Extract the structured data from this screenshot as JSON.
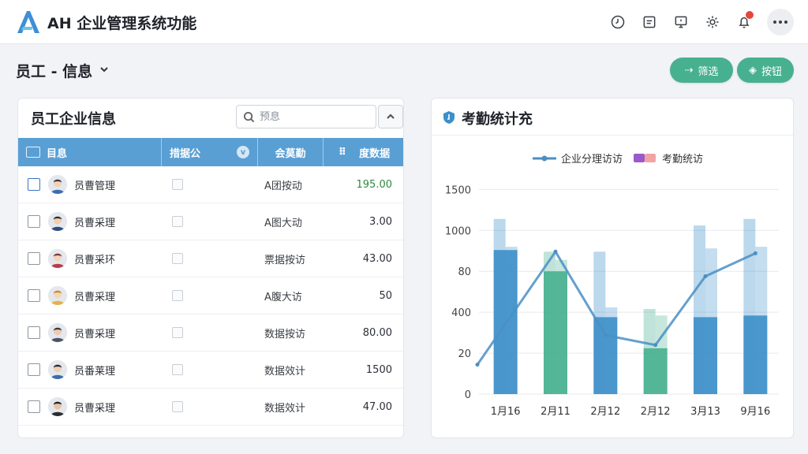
{
  "app": {
    "title": "AH 企业管理系统功能",
    "logo_icon": "a-logo-icon"
  },
  "topbar": {
    "icons": [
      "clock-icon",
      "document-icon",
      "monitor-icon",
      "gear-icon",
      "bell-icon",
      "more-icon"
    ]
  },
  "page": {
    "title": "员工 - 信息"
  },
  "actions": {
    "filter_label": "筛选",
    "export_label": "按钮"
  },
  "table_card": {
    "title": "员工企业信息",
    "search_placeholder": "预息",
    "columns": [
      "目息",
      "措据公",
      "会莫勤",
      "度数据"
    ],
    "rows": [
      {
        "name": "员曹管理",
        "dept": "A团按动",
        "value": "195.00",
        "value_color": "#2f8a3e"
      },
      {
        "name": "员曹采理",
        "dept": "A图大动",
        "value": "3.00"
      },
      {
        "name": "员曹采环",
        "dept": "票据按访",
        "value": "43.00"
      },
      {
        "name": "员曹采理",
        "dept": "A腹大访",
        "value": "50"
      },
      {
        "name": "员曹采理",
        "dept": "数据按访",
        "value": "80.00"
      },
      {
        "name": "员番莱理",
        "dept": "数据效计",
        "value": "1500"
      },
      {
        "name": "员曹采理",
        "dept": "数据效计",
        "value": "47.00"
      }
    ]
  },
  "chart_card": {
    "title": "考勤统计充"
  },
  "chart_data": {
    "type": "bar",
    "categories": [
      "1月16",
      "2月11",
      "2月12",
      "2月12",
      "3月13",
      "9月16"
    ],
    "series": [
      {
        "name": "企业分理访访",
        "kind": "line",
        "color": "#4a8fc4",
        "values": [
          180,
          870,
          360,
          300,
          720,
          860
        ]
      },
      {
        "name": "考勤统访",
        "kind": "bar",
        "values": [
          880,
          750,
          470,
          280,
          470,
          480
        ]
      }
    ],
    "background_bars": [
      1070,
      870,
      870,
      520,
      1030,
      1070
    ],
    "secondary_bars": [
      900,
      820,
      530,
      480,
      890,
      900
    ],
    "bar_colors": [
      "#3d8fc9",
      "#47b08f",
      "#3d8fc9",
      "#47b08f",
      "#3d8fc9",
      "#3d8fc9"
    ],
    "y_ticks": [
      "0",
      "20",
      "400",
      "80",
      "1000",
      "1500"
    ],
    "y_tick_values": [
      0,
      250,
      500,
      750,
      1000,
      1250
    ],
    "ylim": [
      0,
      1300
    ],
    "grid": true,
    "legend_position": "top-center"
  }
}
